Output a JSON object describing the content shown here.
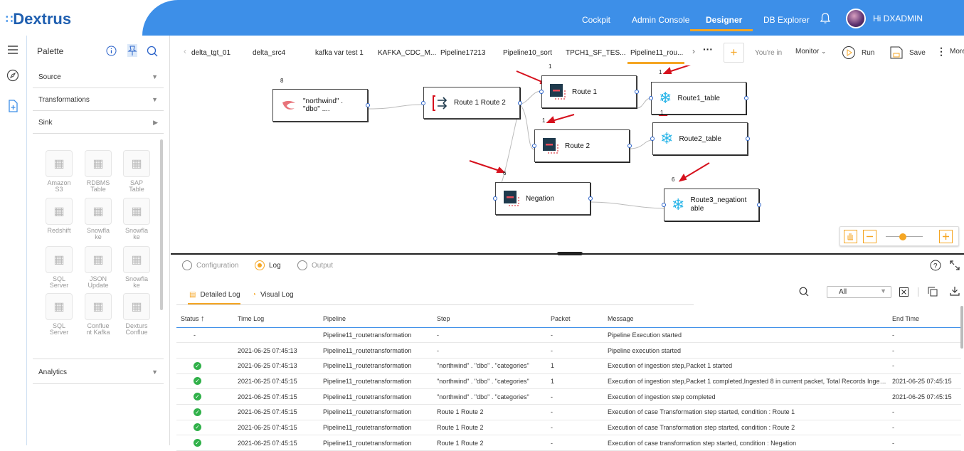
{
  "app": {
    "logo_text": "Dextrus"
  },
  "nav": {
    "items": [
      "Cockpit",
      "Admin Console",
      "Designer",
      "DB Explorer"
    ],
    "greeting": "Hi DXADMIN"
  },
  "palette": {
    "title": "Palette",
    "sections": {
      "source": "Source",
      "transformations": "Transformations",
      "sink": "Sink",
      "analytics": "Analytics"
    },
    "tiles": [
      [
        "Amazon",
        "S3"
      ],
      [
        "RDBMS",
        "Table"
      ],
      [
        "SAP",
        "Table"
      ],
      [
        "Redshift",
        ""
      ],
      [
        "Snowfla",
        "ke"
      ],
      [
        "Snowfla",
        "ke"
      ],
      [
        "SQL",
        "Server"
      ],
      [
        "JSON",
        "Update"
      ],
      [
        "Snowfla",
        "ke"
      ],
      [
        "SQL",
        "Server"
      ],
      [
        "Conflue",
        "nt Kafka"
      ],
      [
        "Dexturs",
        "Conflue"
      ]
    ]
  },
  "tabs": [
    "delta_tgt_01",
    "delta_src4",
    "kafka var test 1",
    "KAFKA_CDC_M...",
    "Pipeline17213",
    "Pipeline10_sort",
    "TPCH1_SF_TES...",
    "Pipeline11_rou..."
  ],
  "toolbar": {
    "youre_in": "You're in",
    "mode": "Monitor",
    "run": "Run",
    "save": "Save",
    "more": "More",
    "overflow": "···",
    "add": "+"
  },
  "nodes": {
    "northwind": {
      "line1": "\"northwind\" .",
      "line2": "\"dbo\" ....",
      "count": "8"
    },
    "route12": {
      "label": "Route 1 Route 2"
    },
    "route1": {
      "label": "Route 1",
      "count": "1"
    },
    "route2": {
      "label": "Route 2",
      "count": "1"
    },
    "negation": {
      "label": "Negation",
      "count": "6"
    },
    "route1_table": {
      "label": "Route1_table",
      "count_top": "1",
      "count_bottom": "1"
    },
    "route2_table": {
      "label": "Route2_table"
    },
    "route3_table": {
      "line1": "Route3_negationt",
      "line2": "able",
      "count": "6"
    }
  },
  "bottom": {
    "radios": {
      "configuration": "Configuration",
      "log": "Log",
      "output": "Output"
    },
    "subtabs": {
      "detailed": "Detailed Log",
      "visual": "Visual Log"
    },
    "filter": "All",
    "columns": [
      "Status",
      "Time Log",
      "Pipeline",
      "Step",
      "Packet",
      "Message",
      "End Time"
    ],
    "rows": [
      {
        "status": "-",
        "time": "",
        "pipeline": "Pipeline11_routetransformation",
        "step": "-",
        "packet": "-",
        "message": "Pipeline Execution started",
        "end": "-"
      },
      {
        "status": "",
        "time": "2021-06-25 07:45:13",
        "pipeline": "Pipeline11_routetransformation",
        "step": "-",
        "packet": "-",
        "message": "Pipeline execution started",
        "end": "-"
      },
      {
        "status": "ok",
        "time": "2021-06-25 07:45:13",
        "pipeline": "Pipeline11_routetransformation",
        "step": "\"northwind\" . \"dbo\" . \"categories\"",
        "packet": "1",
        "message": "Execution of ingestion step,Packet 1 started",
        "end": "-"
      },
      {
        "status": "ok",
        "time": "2021-06-25 07:45:15",
        "pipeline": "Pipeline11_routetransformation",
        "step": "\"northwind\" . \"dbo\" . \"categories\"",
        "packet": "1",
        "message": "Execution of ingestion step,Packet 1 completed,Ingested 8 in current packet, Total Records Inges...",
        "end": "2021-06-25 07:45:15"
      },
      {
        "status": "ok",
        "time": "2021-06-25 07:45:15",
        "pipeline": "Pipeline11_routetransformation",
        "step": "\"northwind\" . \"dbo\" . \"categories\"",
        "packet": "-",
        "message": "Execution of ingestion step completed",
        "end": "2021-06-25 07:45:15"
      },
      {
        "status": "ok",
        "time": "2021-06-25 07:45:15",
        "pipeline": "Pipeline11_routetransformation",
        "step": "Route 1 Route 2",
        "packet": "-",
        "message": "Execution of case Transformation step started, condition : Route 1",
        "end": "-"
      },
      {
        "status": "ok",
        "time": "2021-06-25 07:45:15",
        "pipeline": "Pipeline11_routetransformation",
        "step": "Route 1 Route 2",
        "packet": "-",
        "message": "Execution of case Transformation step started, condition : Route 2",
        "end": "-"
      },
      {
        "status": "ok",
        "time": "2021-06-25 07:45:15",
        "pipeline": "Pipeline11_routetransformation",
        "step": "Route 1 Route 2",
        "packet": "-",
        "message": "Execution of case transformation step started, condition : Negation",
        "end": "-"
      }
    ]
  },
  "colors": {
    "brand": "#3d8fe8",
    "accent": "#f5a623",
    "success": "#31b14a"
  }
}
